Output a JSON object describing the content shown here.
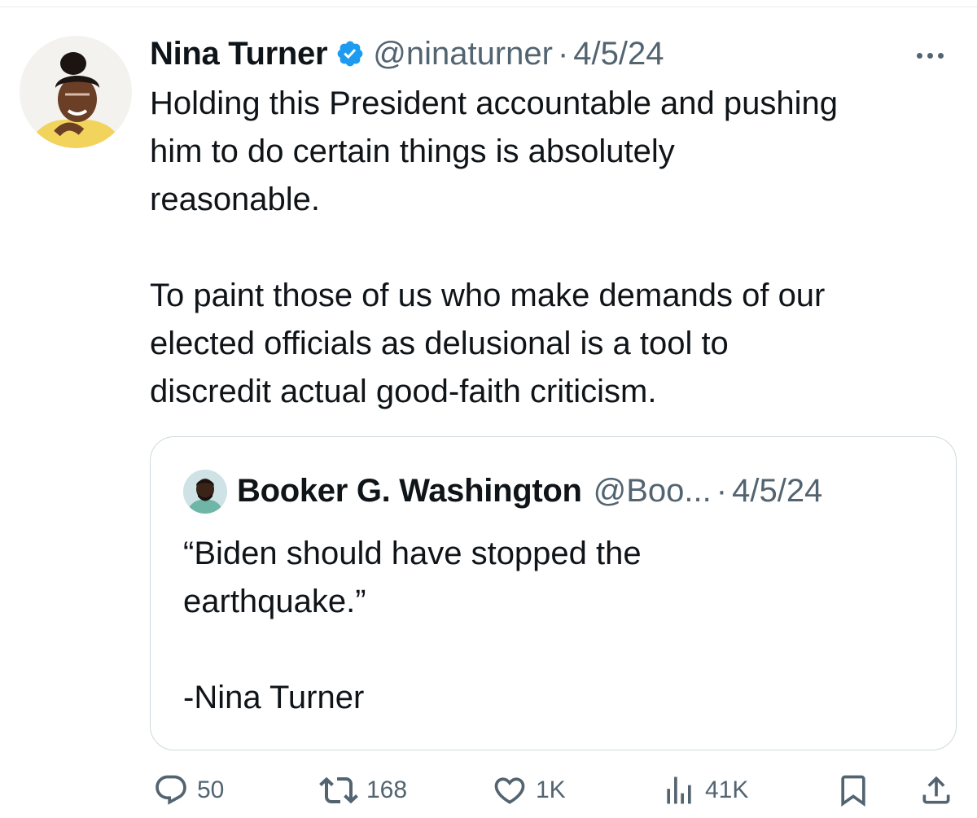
{
  "tweet": {
    "display_name": "Nina Turner",
    "handle": "@ninaturner",
    "separator": "·",
    "date": "4/5/24",
    "verified_icon": "verified-badge-icon",
    "text": "Holding this President accountable and pushing\nhim to do certain things is absolutely\nreasonable.\n\nTo paint those of us who make demands of our\nelected officials as delusional is a tool to\ndiscredit actual good-faith criticism."
  },
  "quote": {
    "display_name": "Booker G. Washington",
    "handle": "@Boo...",
    "separator": "·",
    "date": "4/5/24",
    "text": "“Biden should have stopped the\nearthquake.”\n\n-Nina Turner"
  },
  "actions": {
    "replies": "50",
    "retweets": "168",
    "likes": "1K",
    "views": "41K"
  },
  "colors": {
    "text_primary": "#0f1419",
    "text_secondary": "#536471",
    "verified_blue": "#1d9bf0",
    "border": "#cfd9de"
  }
}
